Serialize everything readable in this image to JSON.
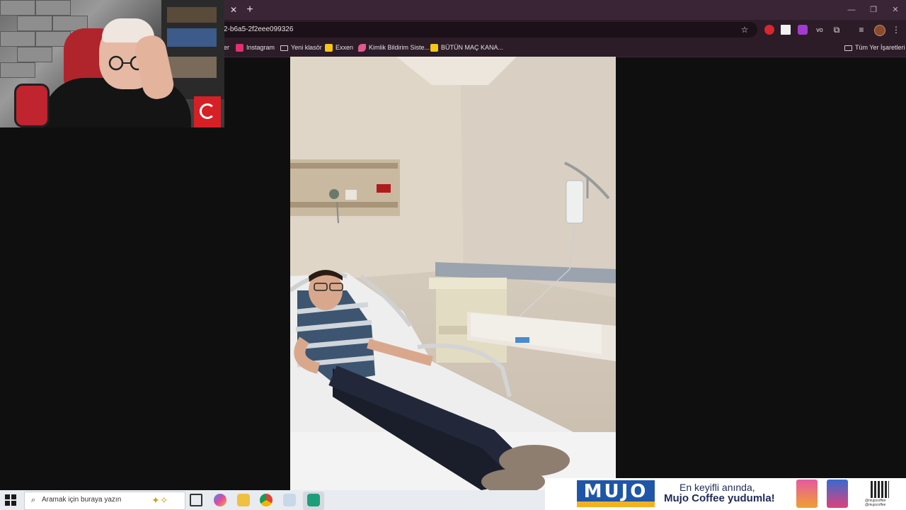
{
  "browser": {
    "url": "2-b6a5-2f2eee099326",
    "bookmarks": [
      {
        "label": "Instagram",
        "icon": "instagram-icon",
        "color": "#e1306c"
      },
      {
        "label": "Yeni klasör",
        "icon": "folder-icon"
      },
      {
        "label": "Exxen",
        "icon": "exxen-icon",
        "color": "#f5c518"
      },
      {
        "label": "Kimlik Bildirim Siste...",
        "icon": "feather-icon",
        "color": "#e05a8a"
      },
      {
        "label": "BÜTÜN MAÇ KANA...",
        "icon": "jp-icon",
        "color": "#f5c518"
      }
    ],
    "all_bookmarks_label": "Tüm Yer İşaretleri",
    "ext_vo_label": "vo",
    "truncated_bookmark_prefix": "er"
  },
  "taskbar": {
    "search_placeholder": "Aramak için buraya yazın"
  },
  "ad": {
    "brand": "MUJO",
    "line1": "En keyifli anında,",
    "line2": "Mujo Coffee yudumla!",
    "social1": "@mujocoffee",
    "social2": "@mujocoffee"
  },
  "colors": {
    "titlebar": "#3a2536",
    "toolbar": "#2b1c28",
    "page_background": "#0f0f0f",
    "taskbar": "#e8ebf0",
    "ad_brand_blue": "#1f56a8"
  }
}
